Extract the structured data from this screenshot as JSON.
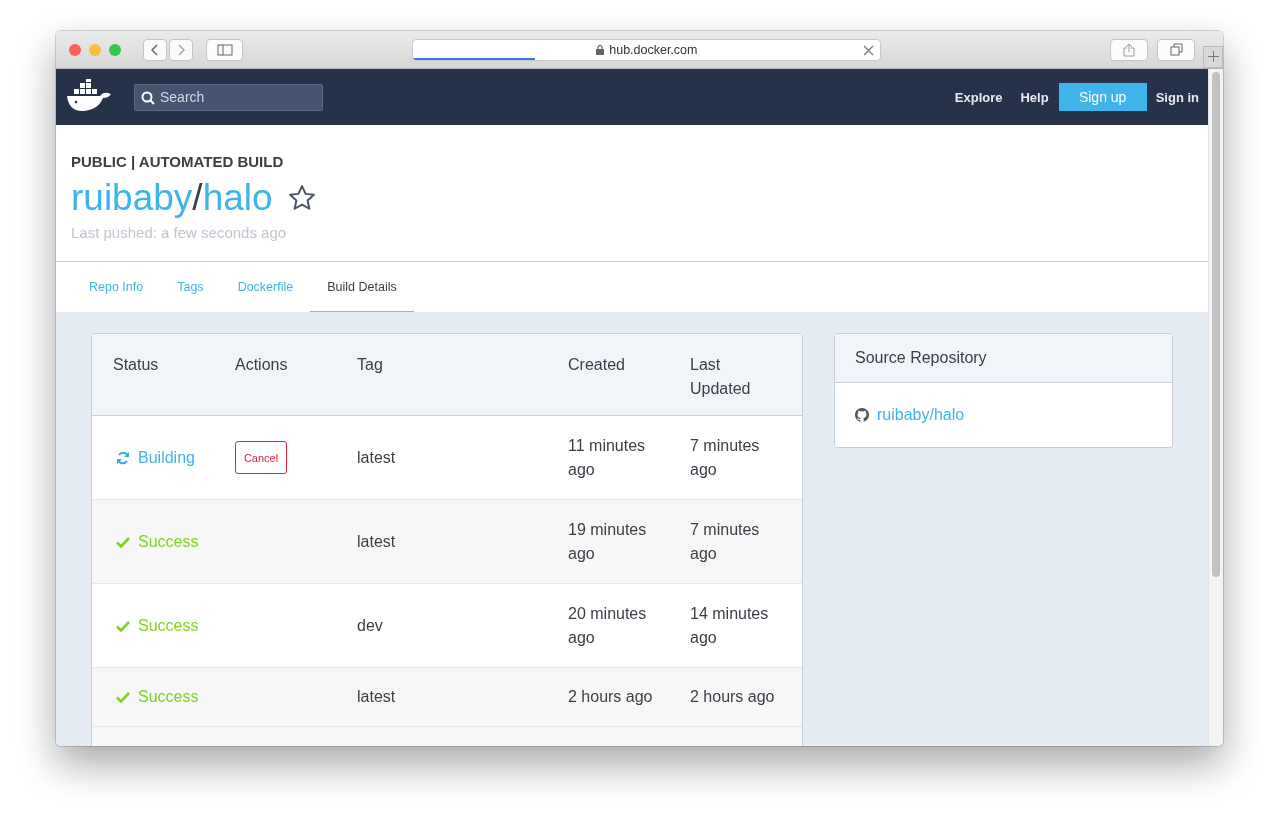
{
  "browser": {
    "url": "hub.docker.com",
    "level": 0.26
  },
  "nav": {
    "search": {
      "placeholder": "Search"
    },
    "links": [
      "Explore",
      "Help"
    ],
    "signup": "Sign up",
    "signin": "Sign in"
  },
  "header": {
    "badge": "PUBLIC | AUTOMATED BUILD",
    "owner": "ruibaby",
    "separator": "/",
    "repo": "halo",
    "starred": false,
    "last_pushed": "Last pushed: a few seconds ago"
  },
  "tabs": [
    {
      "label": "Repo Info",
      "selected": false
    },
    {
      "label": "Tags",
      "selected": false
    },
    {
      "label": "Dockerfile",
      "selected": false
    },
    {
      "label": "Build Details",
      "selected": true
    }
  ],
  "table": {
    "columns": [
      "Status",
      "Actions",
      "Tag",
      "Created",
      "Last Updated"
    ],
    "rows": [
      {
        "status": {
          "kind": "building",
          "label": "Building"
        },
        "action": "Cancel",
        "tag": "latest",
        "created": "11 minutes ago",
        "updated": "7 minutes ago"
      },
      {
        "status": {
          "kind": "success",
          "label": "Success"
        },
        "tag": "latest",
        "created": "19 minutes ago",
        "updated": "7 minutes ago"
      },
      {
        "status": {
          "kind": "success",
          "label": "Success"
        },
        "tag": "dev",
        "created": "20 minutes ago",
        "updated": "14 minutes ago"
      },
      {
        "status": {
          "kind": "success",
          "label": "Success"
        },
        "tag": "latest",
        "created": "2 hours ago",
        "updated": "2 hours ago"
      }
    ]
  },
  "source": {
    "title": "Source Repository",
    "link": "ruibaby/halo"
  }
}
